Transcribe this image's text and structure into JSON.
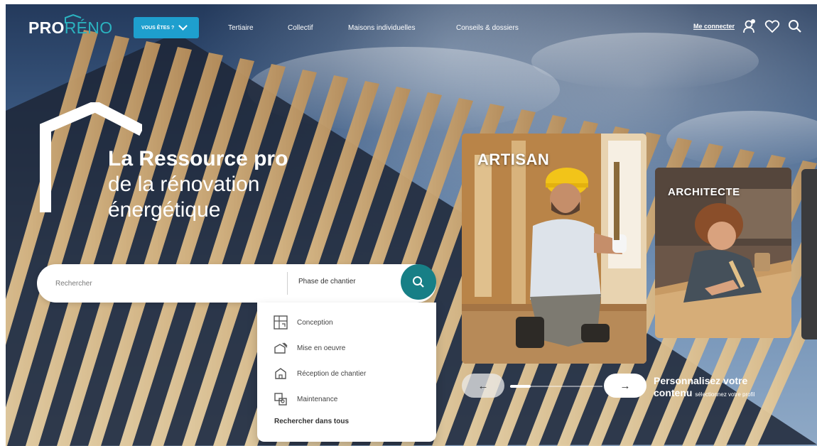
{
  "nav": {
    "logo_pro": "PRO",
    "logo_reno": "RÉNO",
    "audience_button": "VOUS ÊTES ?",
    "links": [
      "Tertiaire",
      "Collectif",
      "Maisons individuelles",
      "Conseils & dossiers"
    ],
    "login": "Me connecter",
    "icons": [
      "user-icon",
      "heart-icon",
      "search-icon"
    ]
  },
  "hero": {
    "title_bold": "La Ressource pro",
    "title_line2": "de la rénovation",
    "title_line3": "énergétique"
  },
  "search": {
    "placeholder": "Rechercher",
    "phase_label": "Phase de chantier",
    "options": [
      {
        "label": "Conception",
        "icon": "blueprint-icon"
      },
      {
        "label": "Mise en oeuvre",
        "icon": "tools-icon"
      },
      {
        "label": "Réception de chantier",
        "icon": "house-icon"
      },
      {
        "label": "Maintenance",
        "icon": "maintenance-icon"
      }
    ],
    "search_all": "Rechercher dans tous"
  },
  "cards": [
    {
      "label": "ARTISAN"
    },
    {
      "label": "ARCHITECTE"
    }
  ],
  "carousel": {
    "prev": "←",
    "next": "→",
    "progress": 0.22
  },
  "personalize": {
    "line1": "Personnalisez votre",
    "line2": "contenu",
    "hint": "sélectionnez votre profil"
  },
  "colors": {
    "accent": "#1e9fce",
    "teal": "#177f86",
    "logo_reno": "#2bb3c0"
  }
}
